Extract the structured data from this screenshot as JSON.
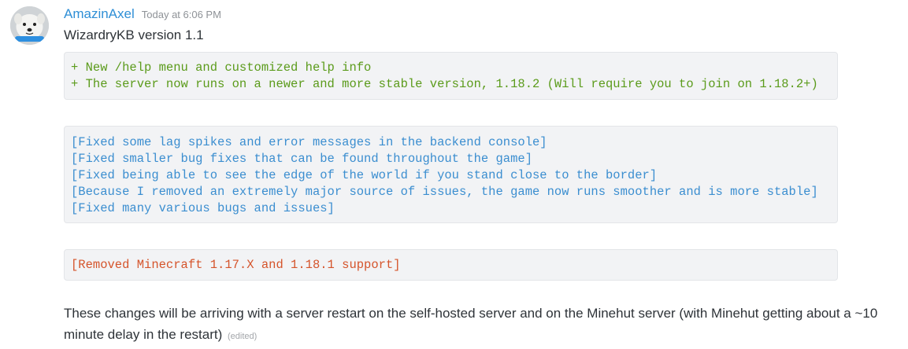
{
  "message": {
    "author": "AmazinAxel",
    "timestamp": "Today at 6:06 PM",
    "avatar_icon": "dog-avatar-icon",
    "title": "WizardryKB version 1.1",
    "diff_block": [
      "+ New /help menu and customized help info",
      "+ The server now runs on a newer and more stable version, 1.18.2 (Will require you to join on 1.18.2+)"
    ],
    "fix_block": [
      "[Fixed some lag spikes and error messages in the backend console]",
      "[Fixed smaller bug fixes that can be found throughout the game]",
      "[Fixed being able to see the edge of the world if you stand close to the border]",
      "[Because I removed an extremely major source of issues, the game now runs smoother and is more stable]",
      "[Fixed many various bugs and issues]"
    ],
    "removed_block": [
      "[Removed Minecraft 1.17.X and 1.18.1 support]"
    ],
    "body": "These changes will be arriving with a server restart on the self-hosted server and on the Minehut server (with Minehut getting about a ~10 minute delay in the restart)",
    "edited_label": "(edited)"
  },
  "colors": {
    "username": "#2f8fd6",
    "diff_green": "#5b9b1b",
    "fix_blue": "#3b8ed0",
    "removed_orange": "#d5542b",
    "code_background": "#f2f3f5"
  }
}
